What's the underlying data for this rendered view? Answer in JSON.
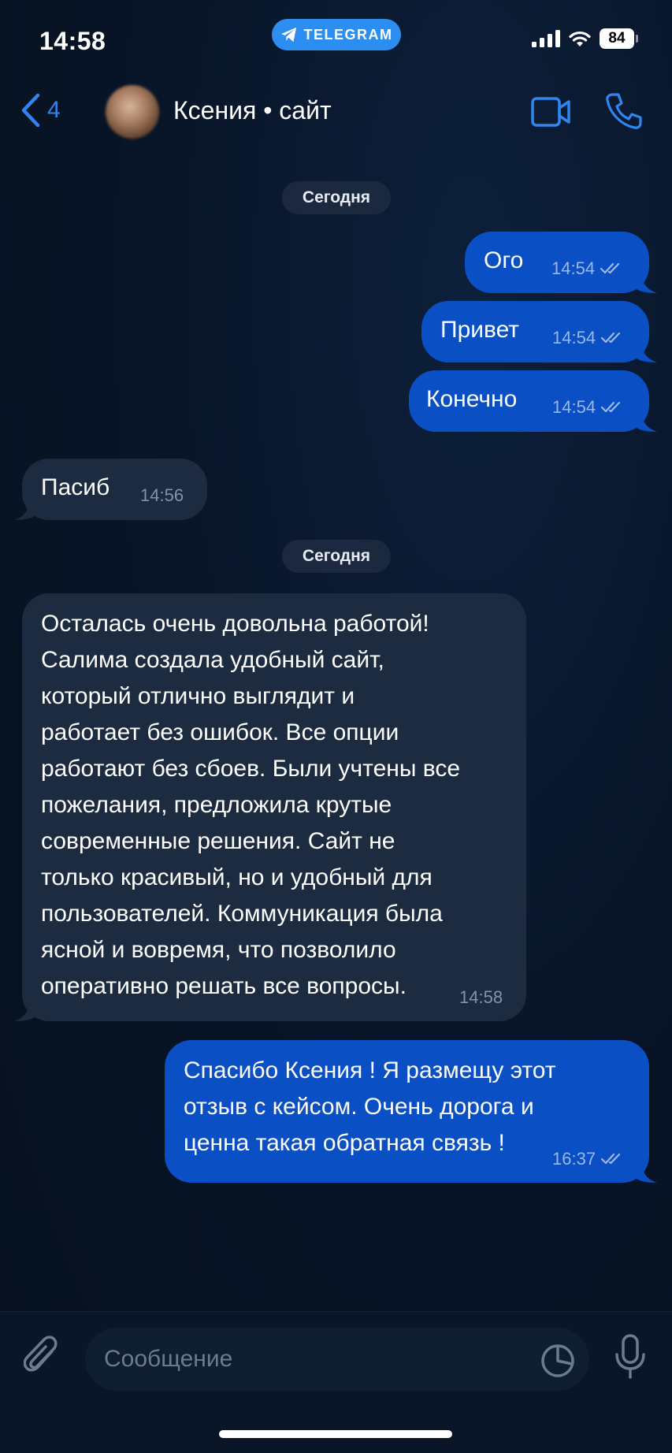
{
  "status_bar": {
    "time": "14:58",
    "app_pill": "TELEGRAM",
    "battery": "84"
  },
  "header": {
    "back_count": "4",
    "chat_title": "Ксения • сайт"
  },
  "date_chips": [
    "Сегодня",
    "Сегодня"
  ],
  "messages": [
    {
      "direction": "outgoing",
      "text": "Ого",
      "time": "14:54",
      "read": true
    },
    {
      "direction": "outgoing",
      "text": "Привет",
      "time": "14:54",
      "read": true
    },
    {
      "direction": "outgoing",
      "text": "Конечно",
      "time": "14:54",
      "read": true
    },
    {
      "direction": "incoming",
      "text": "Пасиб",
      "time": "14:56"
    },
    {
      "direction": "incoming",
      "text": "Осталась очень довольна работой!\nСалима создала удобный сайт,\nкоторый отлично выглядит и\nработает без ошибок. Все опции\nработают без сбоев. Были учтены все\nпожелания, предложила крутые\nсовременные решения. Сайт не\nтолько красивый, но и удобный для\nпользователей. Коммуникация была\nясной и вовремя, что позволило\nоперативно решать все вопросы.",
      "time": "14:58"
    },
    {
      "direction": "outgoing",
      "text": "Спасибо Ксения ! Я размещу этот\nотзыв с кейсом. Очень дорога и\nценна такая обратная связь !",
      "time": "16:37",
      "read": true
    }
  ],
  "composer": {
    "placeholder": "Сообщение"
  },
  "icons": {
    "back": "chevron-left-icon",
    "video": "video-camera-icon",
    "call": "phone-icon",
    "attach": "paperclip-icon",
    "sticker": "sticker-icon",
    "mic": "microphone-icon",
    "read": "double-check-icon"
  },
  "colors": {
    "accent": "#2f86f0",
    "outgoing_bubble": "#0a4fc4",
    "incoming_bubble": "#1d2b40",
    "background": "#081426"
  }
}
